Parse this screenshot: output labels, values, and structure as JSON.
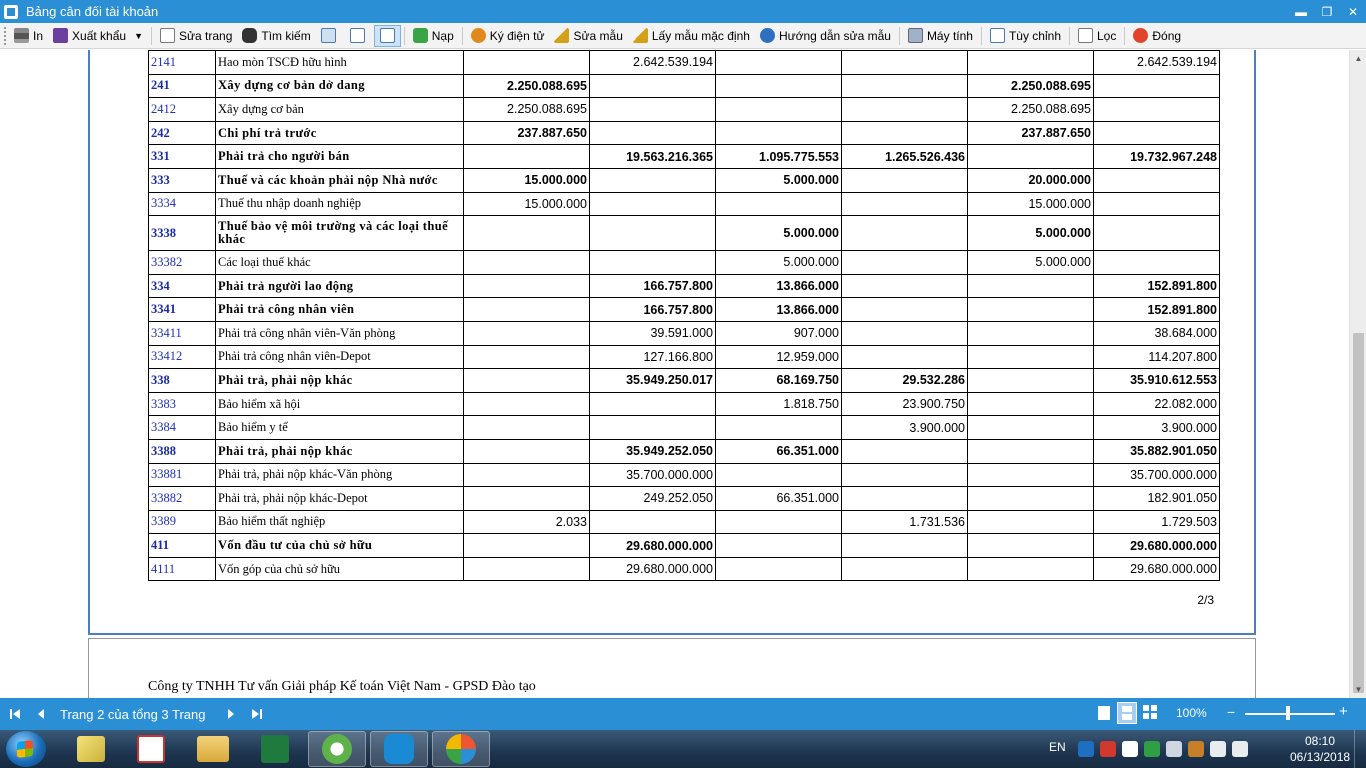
{
  "window": {
    "title": "Bảng cân đối tài khoản",
    "minimize": "▬",
    "restore": "❐",
    "close": "✕"
  },
  "toolbar": {
    "print": "In",
    "export": "Xuất khẩu",
    "edit_page": "Sửa trang",
    "search": "Tìm kiếm",
    "load": "Nạp",
    "sign": "Ký điện tử",
    "edit_template": "Sửa mẫu",
    "default_template": "Lấy mẫu mặc định",
    "template_help": "Hướng dẫn sửa mẫu",
    "calculator": "Máy tính",
    "options": "Tùy chỉnh",
    "filter": "Lọc",
    "close": "Đóng"
  },
  "report": {
    "rows": [
      {
        "code": "2141",
        "name": "Hao mòn TSCĐ hữu hình",
        "c1": "",
        "c2": "2.642.539.194",
        "c3": "",
        "c4": "",
        "c5": "",
        "c6": "2.642.539.194",
        "bold": false
      },
      {
        "code": "241",
        "name": "Xây dựng cơ bản dở dang",
        "c1": "2.250.088.695",
        "c2": "",
        "c3": "",
        "c4": "",
        "c5": "2.250.088.695",
        "c6": "",
        "bold": true
      },
      {
        "code": "2412",
        "name": "Xây dựng cơ bản",
        "c1": "2.250.088.695",
        "c2": "",
        "c3": "",
        "c4": "",
        "c5": "2.250.088.695",
        "c6": "",
        "bold": false
      },
      {
        "code": "242",
        "name": "Chi phí trả trước",
        "c1": "237.887.650",
        "c2": "",
        "c3": "",
        "c4": "",
        "c5": "237.887.650",
        "c6": "",
        "bold": true
      },
      {
        "code": "331",
        "name": "Phải trả cho người bán",
        "c1": "",
        "c2": "19.563.216.365",
        "c3": "1.095.775.553",
        "c4": "1.265.526.436",
        "c5": "",
        "c6": "19.732.967.248",
        "bold": true
      },
      {
        "code": "333",
        "name": "Thuế và các khoản phải nộp Nhà nước",
        "c1": "15.000.000",
        "c2": "",
        "c3": "5.000.000",
        "c4": "",
        "c5": "20.000.000",
        "c6": "",
        "bold": true
      },
      {
        "code": "3334",
        "name": "Thuế thu nhập doanh nghiệp",
        "c1": "15.000.000",
        "c2": "",
        "c3": "",
        "c4": "",
        "c5": "15.000.000",
        "c6": "",
        "bold": false
      },
      {
        "code": "3338",
        "name": "Thuế bảo vệ môi trường và các loại thuế khác",
        "c1": "",
        "c2": "",
        "c3": "5.000.000",
        "c4": "",
        "c5": "5.000.000",
        "c6": "",
        "bold": true,
        "tall": true
      },
      {
        "code": "33382",
        "name": "Các loại thuế khác",
        "c1": "",
        "c2": "",
        "c3": "5.000.000",
        "c4": "",
        "c5": "5.000.000",
        "c6": "",
        "bold": false
      },
      {
        "code": "334",
        "name": "Phải trả người lao động",
        "c1": "",
        "c2": "166.757.800",
        "c3": "13.866.000",
        "c4": "",
        "c5": "",
        "c6": "152.891.800",
        "bold": true
      },
      {
        "code": "3341",
        "name": "Phải trả công nhân viên",
        "c1": "",
        "c2": "166.757.800",
        "c3": "13.866.000",
        "c4": "",
        "c5": "",
        "c6": "152.891.800",
        "bold": true
      },
      {
        "code": "33411",
        "name": "Phải trả công nhân viên-Văn phòng",
        "c1": "",
        "c2": "39.591.000",
        "c3": "907.000",
        "c4": "",
        "c5": "",
        "c6": "38.684.000",
        "bold": false
      },
      {
        "code": "33412",
        "name": "Phải trả công nhân viên-Depot",
        "c1": "",
        "c2": "127.166.800",
        "c3": "12.959.000",
        "c4": "",
        "c5": "",
        "c6": "114.207.800",
        "bold": false
      },
      {
        "code": "338",
        "name": "Phải trả, phải nộp khác",
        "c1": "",
        "c2": "35.949.250.017",
        "c3": "68.169.750",
        "c4": "29.532.286",
        "c5": "",
        "c6": "35.910.612.553",
        "bold": true
      },
      {
        "code": "3383",
        "name": "Bảo hiểm xã hội",
        "c1": "",
        "c2": "",
        "c3": "1.818.750",
        "c4": "23.900.750",
        "c5": "",
        "c6": "22.082.000",
        "bold": false
      },
      {
        "code": "3384",
        "name": "Bảo hiểm y tế",
        "c1": "",
        "c2": "",
        "c3": "",
        "c4": "3.900.000",
        "c5": "",
        "c6": "3.900.000",
        "bold": false
      },
      {
        "code": "3388",
        "name": "Phải trả, phải nộp khác",
        "c1": "",
        "c2": "35.949.252.050",
        "c3": "66.351.000",
        "c4": "",
        "c5": "",
        "c6": "35.882.901.050",
        "bold": true
      },
      {
        "code": "33881",
        "name": "Phải trả, phải nộp khác-Văn phòng",
        "c1": "",
        "c2": "35.700.000.000",
        "c3": "",
        "c4": "",
        "c5": "",
        "c6": "35.700.000.000",
        "bold": false
      },
      {
        "code": "33882",
        "name": "Phải trả, phải nộp khác-Depot",
        "c1": "",
        "c2": "249.252.050",
        "c3": "66.351.000",
        "c4": "",
        "c5": "",
        "c6": "182.901.050",
        "bold": false
      },
      {
        "code": "3389",
        "name": "Bảo hiểm thất nghiệp",
        "c1": "2.033",
        "c2": "",
        "c3": "",
        "c4": "1.731.536",
        "c5": "",
        "c6": "1.729.503",
        "bold": false
      },
      {
        "code": "411",
        "name": "Vốn đầu tư của chủ sở hữu",
        "c1": "",
        "c2": "29.680.000.000",
        "c3": "",
        "c4": "",
        "c5": "",
        "c6": "29.680.000.000",
        "bold": true
      },
      {
        "code": "4111",
        "name": "Vốn góp của chủ sở hữu",
        "c1": "",
        "c2": "29.680.000.000",
        "c3": "",
        "c4": "",
        "c5": "",
        "c6": "29.680.000.000",
        "bold": false
      }
    ],
    "page_number": "2/3",
    "company": "Công ty TNHH Tư vấn Giải pháp Kế toán Việt Nam - GPSD Đào tạo"
  },
  "navbar": {
    "page_status": "Trang 2 của tổng 3 Trang",
    "zoom": "100%",
    "zoom_level_percent": 100
  },
  "taskbar": {
    "language": "EN",
    "time": "08:10",
    "date": "06/13/2018"
  },
  "colors": {
    "accent": "#2b8fd6",
    "code_blue": "#1f2fc0",
    "page_border": "#4a7fc0"
  }
}
